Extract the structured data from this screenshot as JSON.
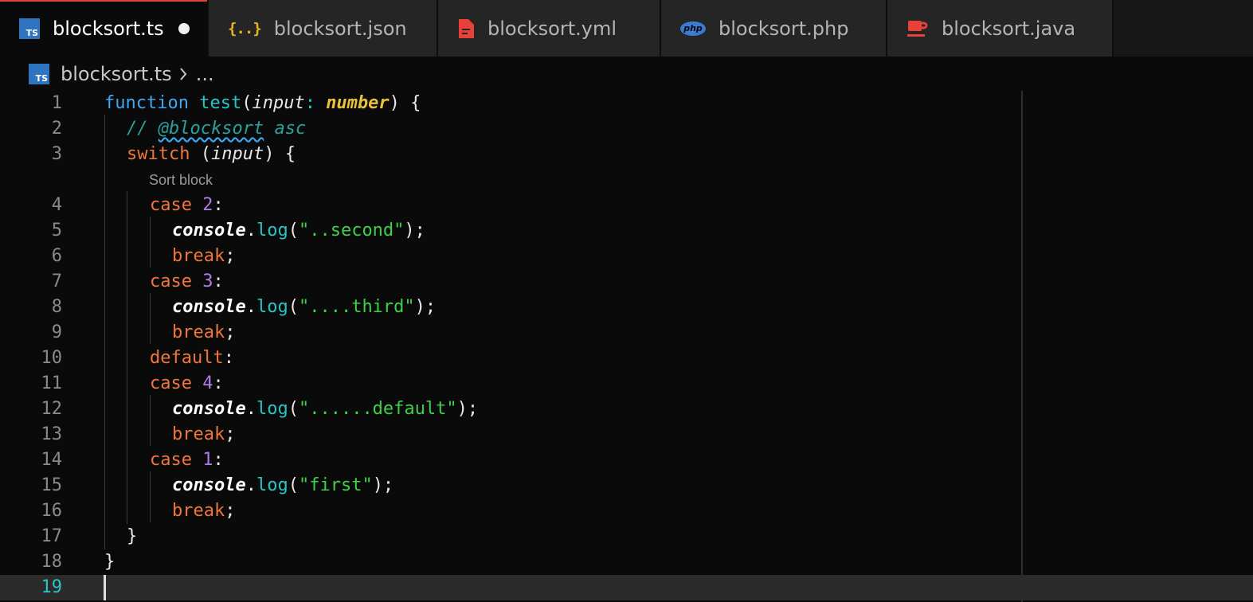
{
  "tabs": [
    {
      "label": "blocksort.ts",
      "icon": "typescript-file-icon",
      "icon_text": "TS",
      "active": true,
      "dirty": true
    },
    {
      "label": "blocksort.json",
      "icon": "json-file-icon",
      "icon_text": "{..}",
      "active": false
    },
    {
      "label": "blocksort.yml",
      "icon": "yaml-file-icon",
      "active": false
    },
    {
      "label": "blocksort.php",
      "icon": "php-file-icon",
      "icon_text": "php",
      "active": false
    },
    {
      "label": "blocksort.java",
      "icon": "java-file-icon",
      "active": false
    }
  ],
  "breadcrumb": {
    "icon_text": "TS",
    "file": "blocksort.ts",
    "more": "..."
  },
  "codelens": "Sort block",
  "colors": {
    "accent_tab": "#e0473a",
    "keyword": "#f0763a",
    "function": "#26c6c6",
    "string": "#3dd14a",
    "number": "#b07ae8",
    "type": "#e8c23a",
    "comment": "#2aa198"
  },
  "lines": [
    {
      "n": "1",
      "t": {
        "kw": "function",
        "fn": "test",
        "p1": "(",
        "param": "input",
        "colon": ":",
        "type": "number",
        "p2": ")",
        "brace": "{"
      }
    },
    {
      "n": "2",
      "t": {
        "slashes": "//",
        "directive": "@blocksort",
        "arg": "asc"
      }
    },
    {
      "n": "3",
      "t": {
        "kw": "switch",
        "p1": "(",
        "param": "input",
        "p2": ")",
        "brace": "{"
      }
    },
    {
      "n": "4",
      "t": {
        "kw": "case",
        "num": "2",
        "colon": ":"
      }
    },
    {
      "n": "5",
      "t": {
        "obj": "console",
        "dot": ".",
        "fn": "log",
        "p1": "(",
        "str": "\"..second\"",
        "p2": ");"
      }
    },
    {
      "n": "6",
      "t": {
        "kw": "break",
        "semi": ";"
      }
    },
    {
      "n": "7",
      "t": {
        "kw": "case",
        "num": "3",
        "colon": ":"
      }
    },
    {
      "n": "8",
      "t": {
        "obj": "console",
        "dot": ".",
        "fn": "log",
        "p1": "(",
        "str": "\"....third\"",
        "p2": ");"
      }
    },
    {
      "n": "9",
      "t": {
        "kw": "break",
        "semi": ";"
      }
    },
    {
      "n": "10",
      "t": {
        "kw": "default",
        "colon": ":"
      }
    },
    {
      "n": "11",
      "t": {
        "kw": "case",
        "num": "4",
        "colon": ":"
      }
    },
    {
      "n": "12",
      "t": {
        "obj": "console",
        "dot": ".",
        "fn": "log",
        "p1": "(",
        "str": "\"......default\"",
        "p2": ");"
      }
    },
    {
      "n": "13",
      "t": {
        "kw": "break",
        "semi": ";"
      }
    },
    {
      "n": "14",
      "t": {
        "kw": "case",
        "num": "1",
        "colon": ":"
      }
    },
    {
      "n": "15",
      "t": {
        "obj": "console",
        "dot": ".",
        "fn": "log",
        "p1": "(",
        "str": "\"first\"",
        "p2": ");"
      }
    },
    {
      "n": "16",
      "t": {
        "kw": "break",
        "semi": ";"
      }
    },
    {
      "n": "17",
      "t": {
        "brace": "}"
      }
    },
    {
      "n": "18",
      "t": {
        "brace": "}"
      }
    },
    {
      "n": "19",
      "t": {}
    }
  ]
}
